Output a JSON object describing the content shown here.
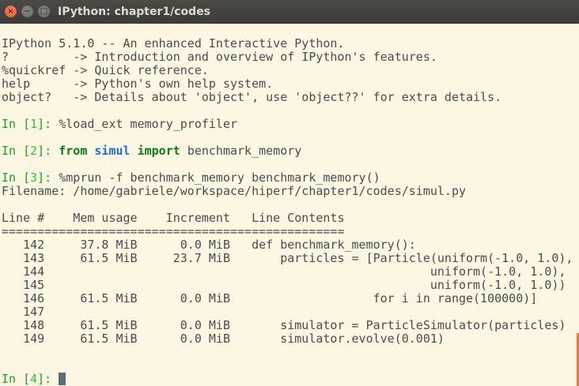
{
  "window": {
    "title": "IPython: chapter1/codes"
  },
  "terminal": {
    "banner": [
      "IPython 5.1.0 -- An enhanced Interactive Python.",
      "?         -> Introduction and overview of IPython's features.",
      "%quickref -> Quick reference.",
      "help      -> Python's own help system.",
      "object?   -> Details about 'object', use 'object??' for extra details."
    ],
    "prompt_in": "In [",
    "prompt_close": "]: ",
    "cells": [
      {
        "num": "1",
        "code": "%load_ext memory_profiler"
      },
      {
        "num": "2",
        "kw1": "from",
        "module": "simul",
        "kw2": "import",
        "rest": "benchmark_memory"
      },
      {
        "num": "3",
        "code": "%mprun -f benchmark_memory benchmark_memory()"
      },
      {
        "num": "4"
      }
    ],
    "output": [
      "Filename: /home/gabriele/workspace/hiperf/chapter1/codes/simul.py",
      "",
      "Line #    Mem usage    Increment   Line Contents",
      "================================================",
      "   142     37.8 MiB      0.0 MiB   def benchmark_memory():",
      "   143     61.5 MiB     23.7 MiB       particles = [Particle(uniform(-1.0, 1.0),",
      "   144                                                      uniform(-1.0, 1.0),",
      "   145                                                      uniform(-1.0, 1.0))",
      "   146     61.5 MiB      0.0 MiB                    for i in range(100000)]",
      "   147",
      "   148     61.5 MiB      0.0 MiB       simulator = ParticleSimulator(particles)",
      "   149     61.5 MiB      0.0 MiB       simulator.evolve(0.001)"
    ]
  },
  "colors": {
    "background": "#fdf6e3",
    "prompt": "#17a024",
    "keyword": "#0b7a1b",
    "module": "#1e6fd8",
    "titlebar": "#3c3b37"
  }
}
